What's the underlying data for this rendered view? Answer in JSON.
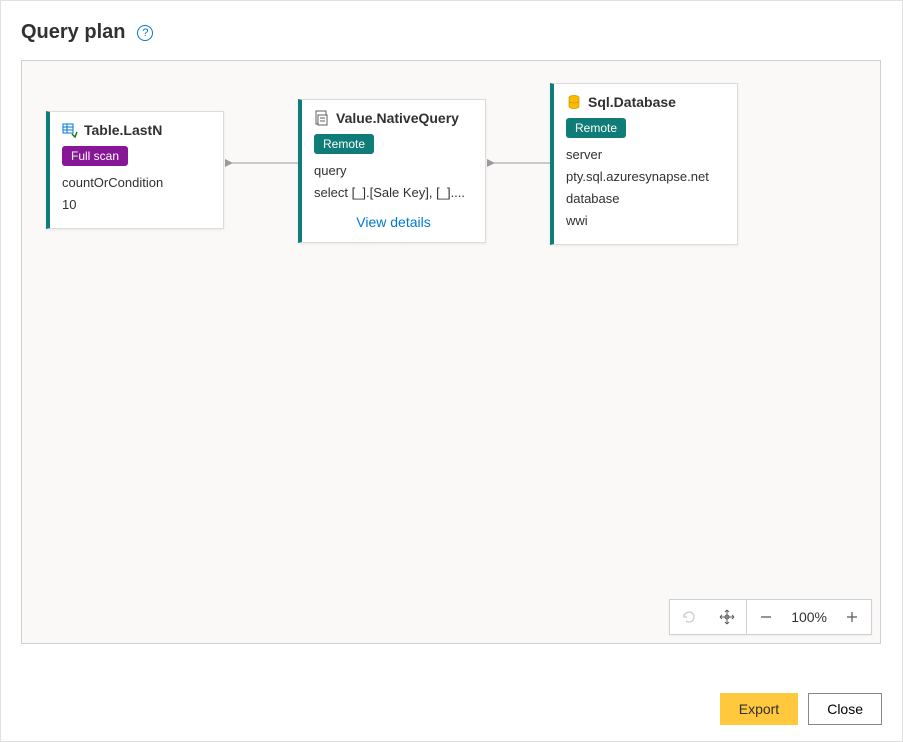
{
  "dialog": {
    "title": "Query plan"
  },
  "nodes": {
    "tableLastN": {
      "title": "Table.LastN",
      "badge": "Full scan",
      "paramLabel": "countOrCondition",
      "paramValue": "10"
    },
    "nativeQuery": {
      "title": "Value.NativeQuery",
      "badge": "Remote",
      "paramLabel": "query",
      "paramValue": "select [_].[Sale Key], [_]....",
      "viewDetails": "View details"
    },
    "sqlDatabase": {
      "title": "Sql.Database",
      "badge": "Remote",
      "serverLabel": "server",
      "serverValue": "pty.sql.azuresynapse.net",
      "databaseLabel": "database",
      "databaseValue": "wwi"
    }
  },
  "toolbar": {
    "zoom": "100%"
  },
  "footer": {
    "export": "Export",
    "close": "Close"
  }
}
